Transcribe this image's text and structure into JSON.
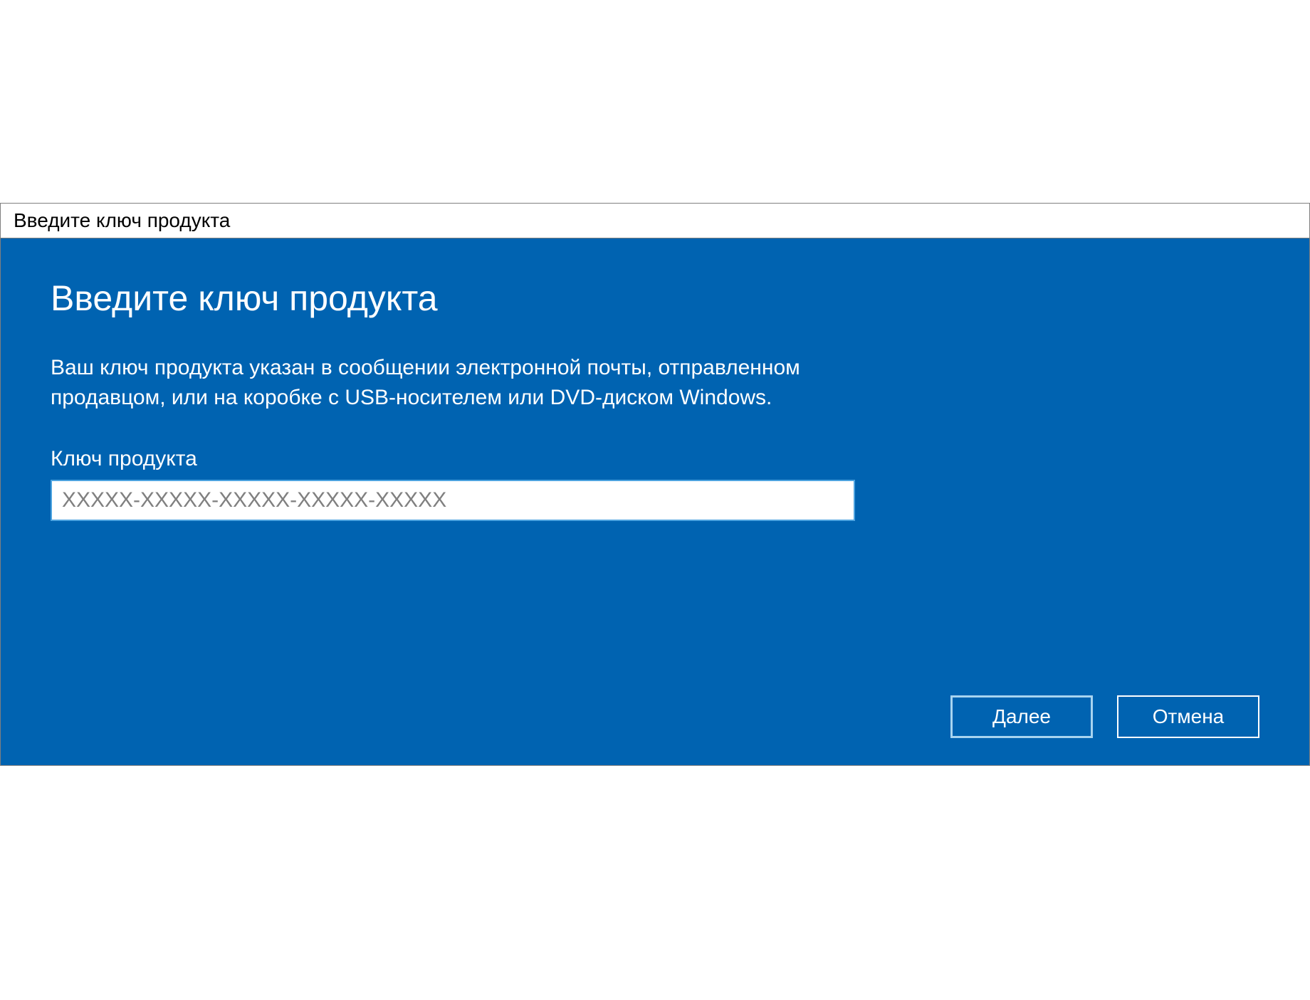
{
  "titleBar": {
    "title": "Введите ключ продукта"
  },
  "dialog": {
    "heading": "Введите ключ продукта",
    "description": "Ваш ключ продукта указан в сообщении электронной почты, отправленном продавцом, или на коробке с USB-носителем или DVD-диском Windows.",
    "inputLabel": "Ключ продукта",
    "inputPlaceholder": "XXXXX-XXXXX-XXXXX-XXXXX-XXXXX",
    "inputValue": ""
  },
  "buttons": {
    "next": "Далее",
    "cancel": "Отмена"
  },
  "colors": {
    "accent": "#0063b1",
    "border": "#808080",
    "inputBorder": "#4da3e0"
  }
}
